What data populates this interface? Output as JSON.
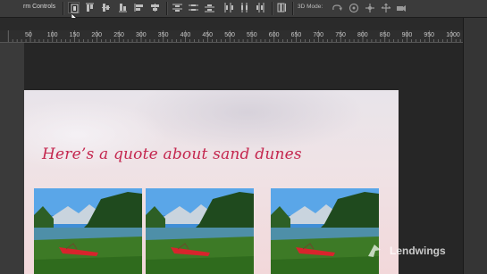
{
  "options_bar": {
    "label": "rm Controls",
    "mode_3d_label": "3D Mode:",
    "active_tool": "show-transform-controls-icon"
  },
  "ruler": {
    "labels": [
      "50",
      "100",
      "150",
      "200",
      "250",
      "300",
      "350",
      "400",
      "450",
      "500",
      "550",
      "600",
      "650",
      "700",
      "750",
      "800",
      "850",
      "900",
      "950",
      "1000"
    ]
  },
  "document": {
    "quote": "Here’s a quote about sand dunes",
    "photos": [
      {
        "name": "lake-photo-1",
        "subject": "mountain lake with red canoe"
      },
      {
        "name": "lake-photo-2",
        "subject": "mountain lake with red canoe"
      },
      {
        "name": "lake-photo-3",
        "subject": "mountain lake with red canoe"
      }
    ]
  },
  "watermark": {
    "text": "Lendwings"
  },
  "colors": {
    "quote": "#c4264e",
    "ui_background": "#262626",
    "options_bar": "#3b3b3b"
  }
}
